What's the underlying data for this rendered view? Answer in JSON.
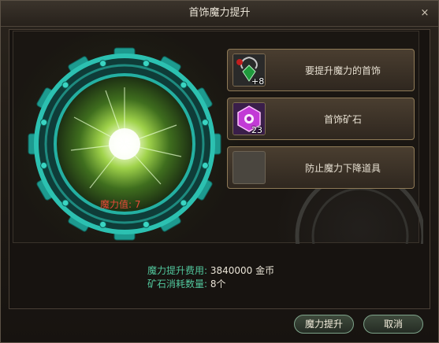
{
  "window": {
    "title": "首饰魔力提升",
    "close_glyph": "×"
  },
  "gear": {
    "magic_label": "魔力值",
    "magic_value": "7",
    "magic_text": "魔力值: 7"
  },
  "slots": [
    {
      "label": "要提升魔力的首饰",
      "count": "+8",
      "icon": "green-gem-necklace-icon"
    },
    {
      "label": "首饰矿石",
      "count": "23",
      "icon": "purple-ore-icon"
    },
    {
      "label": "防止魔力下降道具",
      "count": "",
      "icon": "empty-slot-icon"
    }
  ],
  "info": {
    "cost_label": "魔力提升费用:",
    "cost_value": "3840000 金币",
    "ore_label": "矿石消耗数量:",
    "ore_value": "8个"
  },
  "buttons": {
    "upgrade": "魔力提升",
    "cancel": "取消"
  },
  "colors": {
    "accent_teal": "#2fb8a8",
    "magic_red": "#e84a3b",
    "info_green": "#52c79d"
  }
}
